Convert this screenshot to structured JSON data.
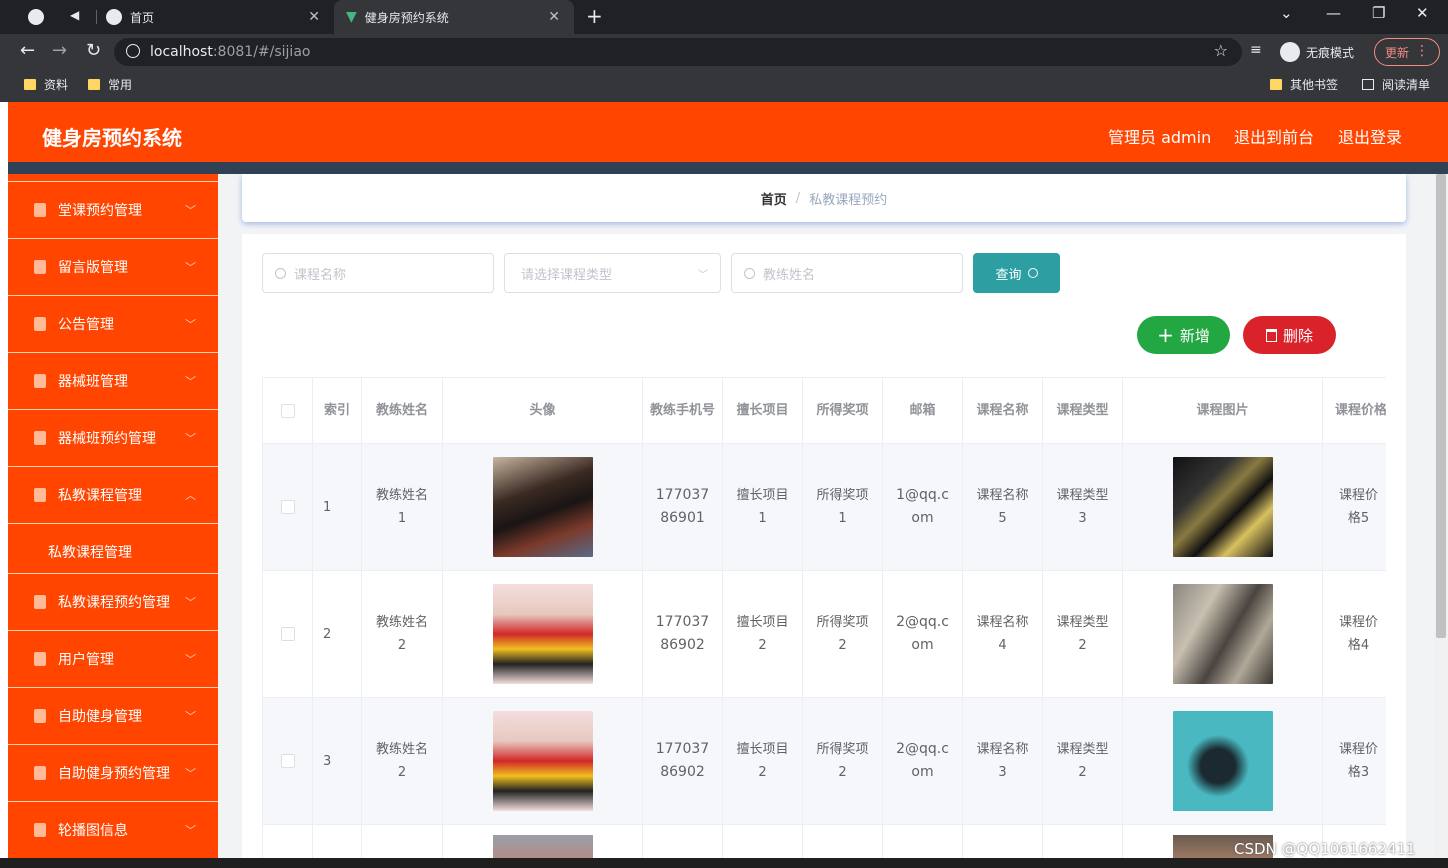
{
  "browser": {
    "tabs": [
      {
        "title": "首页"
      },
      {
        "title": "健身房预约系统"
      }
    ],
    "url_host": "localhost",
    "url_rest": ":8081/#/sijiao",
    "incognito_label": "无痕模式",
    "update_label": "更新",
    "bookmarks": [
      "资料",
      "常用"
    ],
    "bookmarks_right": [
      "其他书签",
      "阅读清单"
    ]
  },
  "header": {
    "brand": "健身房预约系统",
    "admin": "管理员 admin",
    "to_front": "退出到前台",
    "logout": "退出登录",
    "color": "#ff4500"
  },
  "sidebar": {
    "items": [
      {
        "label": "堂课预约管理",
        "icon": "microphone-icon"
      },
      {
        "label": "留言版管理",
        "icon": "document-x-icon"
      },
      {
        "label": "公告管理",
        "icon": "bar-chart-icon"
      },
      {
        "label": "器械班管理",
        "icon": "brush-icon"
      },
      {
        "label": "器械班预约管理",
        "icon": "clipboard-check-icon"
      },
      {
        "label": "私教课程管理",
        "icon": "printer-icon",
        "expanded": true,
        "sub": "私教课程管理"
      },
      {
        "label": "私教课程预约管理",
        "icon": "crop-icon"
      },
      {
        "label": "用户管理",
        "icon": "location-icon"
      },
      {
        "label": "自助健身管理",
        "icon": "fullscreen-icon"
      },
      {
        "label": "自助健身预约管理",
        "icon": "clock-icon"
      },
      {
        "label": "轮播图信息",
        "icon": "tickets-icon"
      }
    ]
  },
  "breadcrumb": {
    "home": "首页",
    "sep": "/",
    "current": "私教课程预约"
  },
  "search": {
    "course_placeholder": "课程名称",
    "type_placeholder": "请选择课程类型",
    "coach_placeholder": "教练姓名",
    "query_label": "查询"
  },
  "actions": {
    "add_label": "新增",
    "delete_label": "删除"
  },
  "table": {
    "headers": [
      "索引",
      "教练姓名",
      "头像",
      "教练手机号",
      "擅长项目",
      "所得奖项",
      "邮箱",
      "课程名称",
      "课程类型",
      "课程图片",
      "课程价格"
    ],
    "rows": [
      {
        "index": "1",
        "coach": "教练姓名1",
        "phone": "17703786901",
        "skill": "擅长项目1",
        "award": "所得奖项1",
        "email": "1@qq.com",
        "course": "课程名称5",
        "type": "课程类型3",
        "price": "课程价格5"
      },
      {
        "index": "2",
        "coach": "教练姓名2",
        "phone": "17703786902",
        "skill": "擅长项目2",
        "award": "所得奖项2",
        "email": "2@qq.com",
        "course": "课程名称4",
        "type": "课程类型2",
        "price": "课程价格4"
      },
      {
        "index": "3",
        "coach": "教练姓名2",
        "phone": "17703786902",
        "skill": "擅长项目2",
        "award": "所得奖项2",
        "email": "2@qq.com",
        "course": "课程名称3",
        "type": "课程类型2",
        "price": "课程价格3"
      }
    ]
  },
  "watermark": "CSDN @QQ1061662411"
}
